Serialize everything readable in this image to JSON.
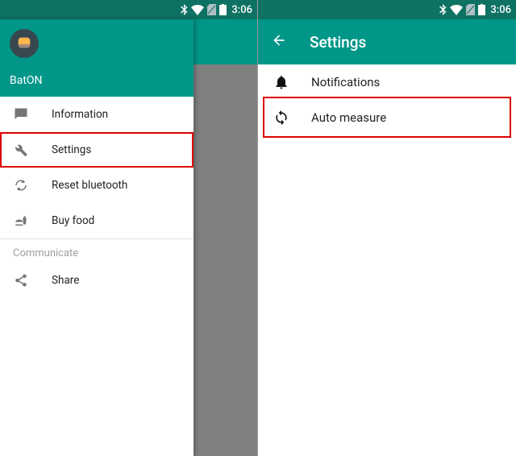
{
  "status": {
    "time": "3:06"
  },
  "left": {
    "app_name": "BatON",
    "items": [
      {
        "label": "Information",
        "icon": "message-icon"
      },
      {
        "label": "Settings",
        "icon": "wrench-icon",
        "highlight": true
      },
      {
        "label": "Reset bluetooth",
        "icon": "reset-icon"
      },
      {
        "label": "Buy food",
        "icon": "food-icon"
      }
    ],
    "section_label": "Communicate",
    "share_label": "Share"
  },
  "right": {
    "title": "Settings",
    "items": [
      {
        "label": "Notifications",
        "icon": "bell-icon"
      },
      {
        "label": "Auto measure",
        "icon": "sync-icon",
        "highlight": true
      }
    ]
  }
}
